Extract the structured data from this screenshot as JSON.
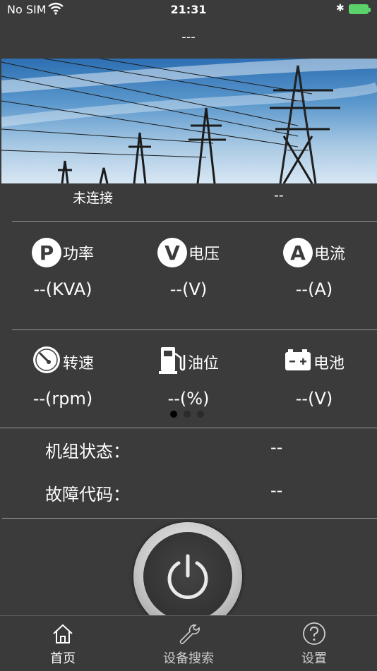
{
  "status_bar": {
    "carrier": "No SIM",
    "time": "21:31"
  },
  "nav": {
    "title": "---"
  },
  "connection": {
    "status": "未连接",
    "value": "--"
  },
  "metrics_row1": [
    {
      "badge": "P",
      "label": "功率",
      "value": "--(KVA)"
    },
    {
      "badge": "V",
      "label": "电压",
      "value": "--(V)"
    },
    {
      "badge": "A",
      "label": "电流",
      "value": "--(A)"
    }
  ],
  "metrics_row2": [
    {
      "icon": "gauge-icon",
      "label": "转速",
      "value": "--(rpm)"
    },
    {
      "icon": "fuel-pump-icon",
      "label": "油位",
      "value": "--(%)"
    },
    {
      "icon": "battery-icon",
      "label": "电池",
      "value": "--(V)"
    }
  ],
  "pager": {
    "pages": 3,
    "active": 0
  },
  "info": [
    {
      "label": "机组状态：",
      "value": "--"
    },
    {
      "label": "故障代码：",
      "value": "--"
    }
  ],
  "tabs": [
    {
      "label": "首页",
      "icon": "home-icon",
      "active": true
    },
    {
      "label": "设备搜索",
      "icon": "wrench-icon",
      "active": false
    },
    {
      "label": "设置",
      "icon": "help-icon",
      "active": false
    }
  ],
  "colors": {
    "background": "#3b3b3b",
    "battery": "#5bd36a",
    "divider": "#9a9a9a"
  }
}
